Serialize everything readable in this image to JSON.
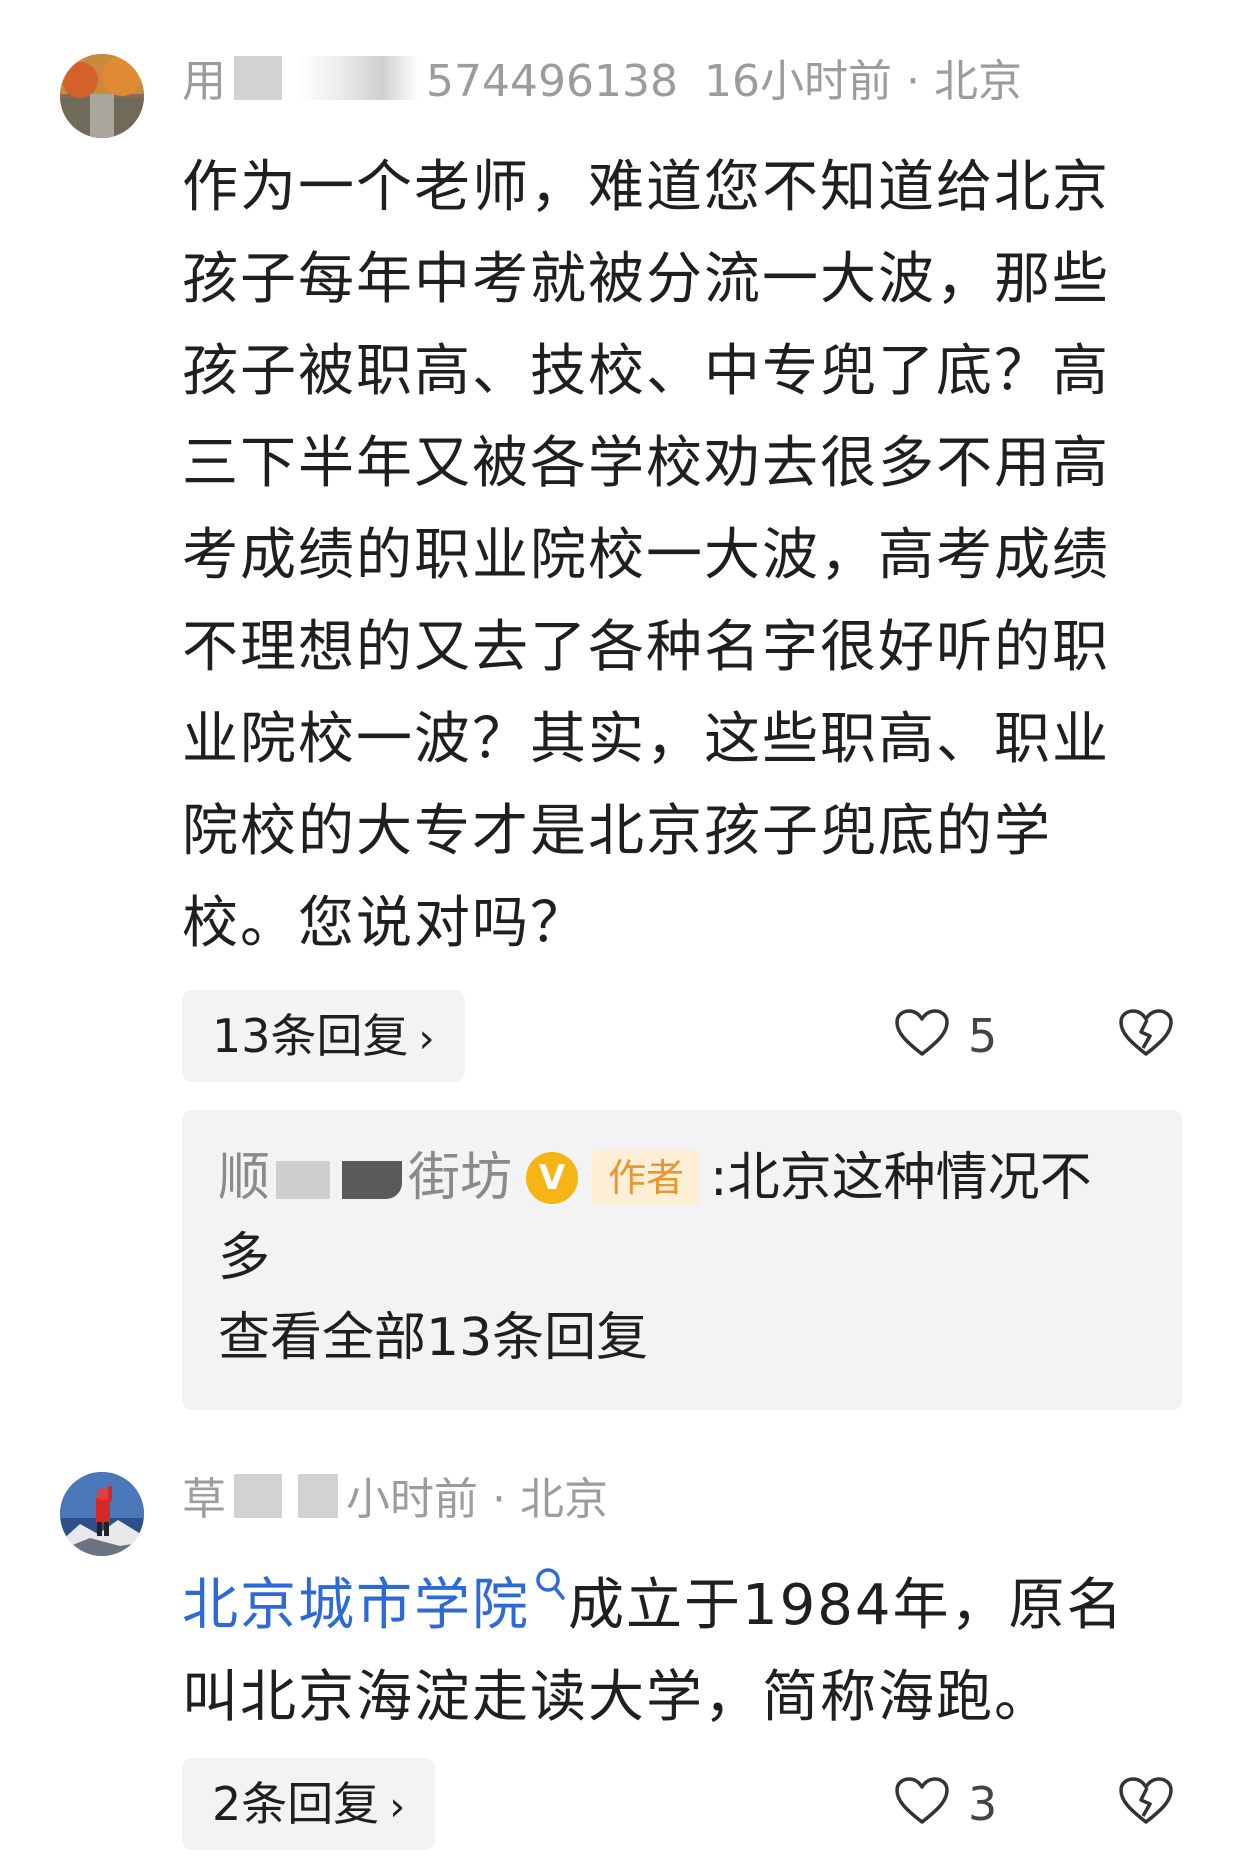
{
  "comments": [
    {
      "username_start": "用",
      "username_end": "574496138",
      "time": "16小时前",
      "separator": "·",
      "location": "北京",
      "text": "作为一个老师，难道您不知道给北京孩子每年中考就被分流一大波，那些孩子被职高、技校、中专兜了底？高三下半年又被各学校劝去很多不用高考成绩的职业院校一大波，高考成绩不理想的又去了各种名字很好听的职业院校一波？其实，这些职高、职业院校的大专才是北京孩子兜底的学校。您说对吗？",
      "replies_label": "13条回复",
      "like_count": "5",
      "top_reply": {
        "author_start": "顺",
        "author_end": "街坊",
        "verified_badge": "V",
        "author_tag": "作者",
        "colon": ":",
        "text_line1": "北京这种情况不",
        "text_line2": "多",
        "view_all": "查看全部13条回复"
      }
    },
    {
      "username_start": "草",
      "time": "小时前",
      "separator": "·",
      "location": "北京",
      "link_text": "北京城市学院",
      "text_after_link": "成立于1984年，原名叫北京海淀走读大学，简称海跑。",
      "replies_label": "2条回复",
      "like_count": "3"
    }
  ],
  "icons": {
    "chevron": "chevron-right-icon",
    "like": "heart-outline-icon",
    "dislike": "broken-heart-icon",
    "search": "search-icon"
  },
  "colors": {
    "link": "#2d6ad6",
    "meta_gray": "#9c9c9c",
    "pill_bg": "#f3f3f5",
    "badge_yellow": "#f5b515",
    "author_tag_bg": "#fdeed6",
    "author_tag_text": "#e59832"
  }
}
